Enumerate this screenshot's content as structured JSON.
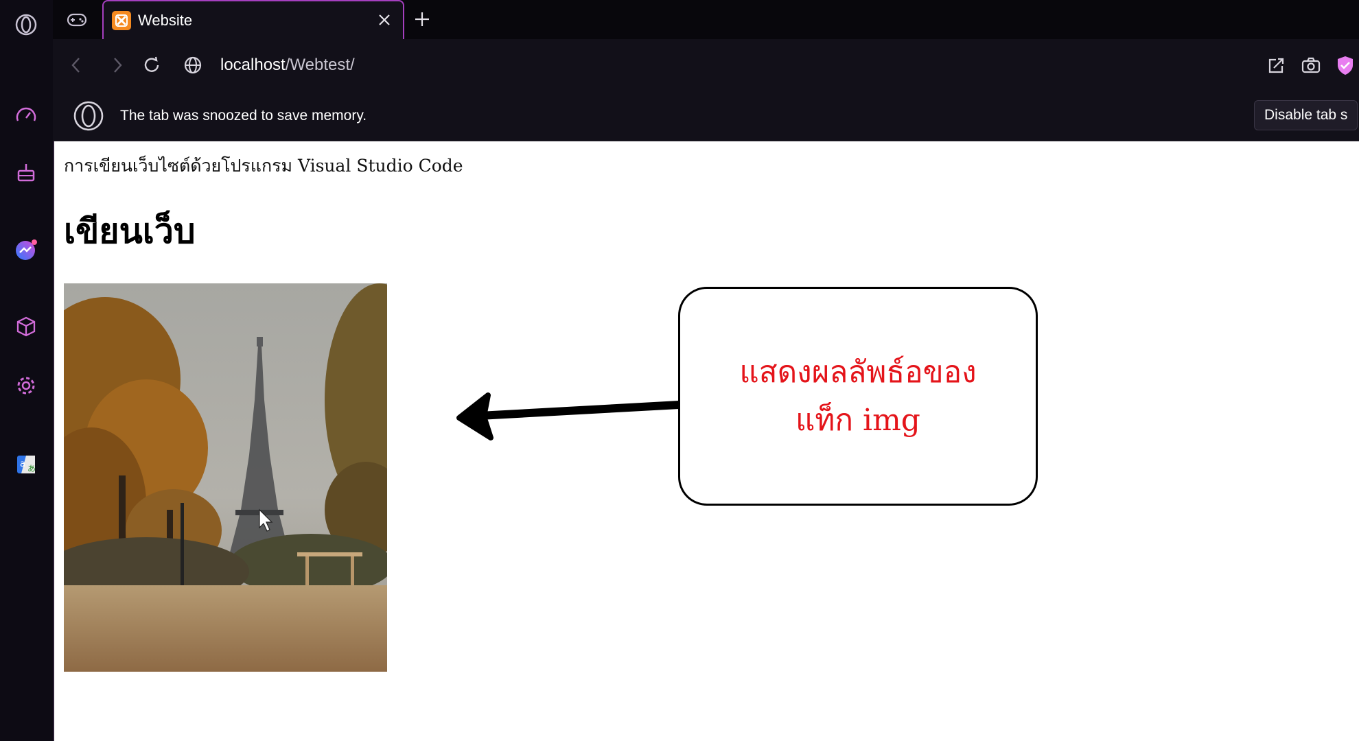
{
  "browser": {
    "tab": {
      "title": "Website"
    },
    "address": {
      "host": "localhost",
      "path": "/Webtest/"
    },
    "snooze": {
      "message": "The tab was snoozed to save memory.",
      "button_label": "Disable tab s"
    },
    "sidebar_icons": [
      "opera-logo-icon",
      "speed-dial-icon",
      "cleaner-icon",
      "messenger-icon",
      "cube-icon",
      "settings-icon",
      "translate-icon"
    ],
    "colors": {
      "accent": "#a53fbf",
      "favicon": "#f58a20",
      "shield": "#e87ef0"
    }
  },
  "page": {
    "subtitle": "การเขียนเว็บไซต์ด้วยโปรแกรม Visual Studio Code",
    "heading": "เขียนเว็บ",
    "image_alt": "Eiffel Tower in autumn"
  },
  "annotation": {
    "line1": "แสดงผลลัพธ์อของ",
    "line2": "แท็ก img",
    "color": "#e4141a"
  }
}
